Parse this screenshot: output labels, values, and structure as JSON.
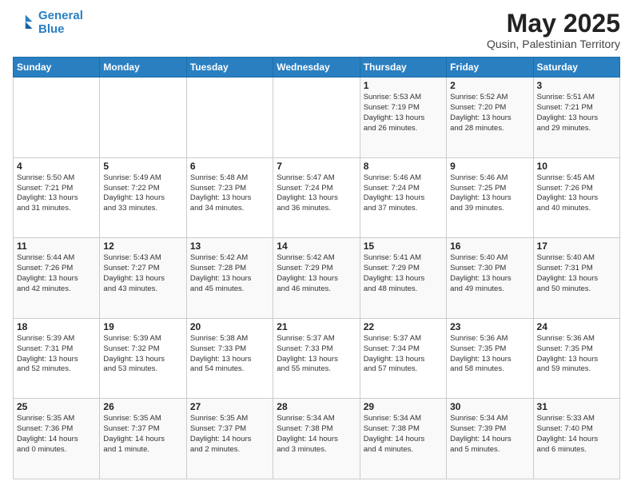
{
  "header": {
    "logo_line1": "General",
    "logo_line2": "Blue",
    "title": "May 2025",
    "subtitle": "Qusin, Palestinian Territory"
  },
  "days_of_week": [
    "Sunday",
    "Monday",
    "Tuesday",
    "Wednesday",
    "Thursday",
    "Friday",
    "Saturday"
  ],
  "weeks": [
    [
      {
        "day": "",
        "info": ""
      },
      {
        "day": "",
        "info": ""
      },
      {
        "day": "",
        "info": ""
      },
      {
        "day": "",
        "info": ""
      },
      {
        "day": "1",
        "info": "Sunrise: 5:53 AM\nSunset: 7:19 PM\nDaylight: 13 hours\nand 26 minutes."
      },
      {
        "day": "2",
        "info": "Sunrise: 5:52 AM\nSunset: 7:20 PM\nDaylight: 13 hours\nand 28 minutes."
      },
      {
        "day": "3",
        "info": "Sunrise: 5:51 AM\nSunset: 7:21 PM\nDaylight: 13 hours\nand 29 minutes."
      }
    ],
    [
      {
        "day": "4",
        "info": "Sunrise: 5:50 AM\nSunset: 7:21 PM\nDaylight: 13 hours\nand 31 minutes."
      },
      {
        "day": "5",
        "info": "Sunrise: 5:49 AM\nSunset: 7:22 PM\nDaylight: 13 hours\nand 33 minutes."
      },
      {
        "day": "6",
        "info": "Sunrise: 5:48 AM\nSunset: 7:23 PM\nDaylight: 13 hours\nand 34 minutes."
      },
      {
        "day": "7",
        "info": "Sunrise: 5:47 AM\nSunset: 7:24 PM\nDaylight: 13 hours\nand 36 minutes."
      },
      {
        "day": "8",
        "info": "Sunrise: 5:46 AM\nSunset: 7:24 PM\nDaylight: 13 hours\nand 37 minutes."
      },
      {
        "day": "9",
        "info": "Sunrise: 5:46 AM\nSunset: 7:25 PM\nDaylight: 13 hours\nand 39 minutes."
      },
      {
        "day": "10",
        "info": "Sunrise: 5:45 AM\nSunset: 7:26 PM\nDaylight: 13 hours\nand 40 minutes."
      }
    ],
    [
      {
        "day": "11",
        "info": "Sunrise: 5:44 AM\nSunset: 7:26 PM\nDaylight: 13 hours\nand 42 minutes."
      },
      {
        "day": "12",
        "info": "Sunrise: 5:43 AM\nSunset: 7:27 PM\nDaylight: 13 hours\nand 43 minutes."
      },
      {
        "day": "13",
        "info": "Sunrise: 5:42 AM\nSunset: 7:28 PM\nDaylight: 13 hours\nand 45 minutes."
      },
      {
        "day": "14",
        "info": "Sunrise: 5:42 AM\nSunset: 7:29 PM\nDaylight: 13 hours\nand 46 minutes."
      },
      {
        "day": "15",
        "info": "Sunrise: 5:41 AM\nSunset: 7:29 PM\nDaylight: 13 hours\nand 48 minutes."
      },
      {
        "day": "16",
        "info": "Sunrise: 5:40 AM\nSunset: 7:30 PM\nDaylight: 13 hours\nand 49 minutes."
      },
      {
        "day": "17",
        "info": "Sunrise: 5:40 AM\nSunset: 7:31 PM\nDaylight: 13 hours\nand 50 minutes."
      }
    ],
    [
      {
        "day": "18",
        "info": "Sunrise: 5:39 AM\nSunset: 7:31 PM\nDaylight: 13 hours\nand 52 minutes."
      },
      {
        "day": "19",
        "info": "Sunrise: 5:39 AM\nSunset: 7:32 PM\nDaylight: 13 hours\nand 53 minutes."
      },
      {
        "day": "20",
        "info": "Sunrise: 5:38 AM\nSunset: 7:33 PM\nDaylight: 13 hours\nand 54 minutes."
      },
      {
        "day": "21",
        "info": "Sunrise: 5:37 AM\nSunset: 7:33 PM\nDaylight: 13 hours\nand 55 minutes."
      },
      {
        "day": "22",
        "info": "Sunrise: 5:37 AM\nSunset: 7:34 PM\nDaylight: 13 hours\nand 57 minutes."
      },
      {
        "day": "23",
        "info": "Sunrise: 5:36 AM\nSunset: 7:35 PM\nDaylight: 13 hours\nand 58 minutes."
      },
      {
        "day": "24",
        "info": "Sunrise: 5:36 AM\nSunset: 7:35 PM\nDaylight: 13 hours\nand 59 minutes."
      }
    ],
    [
      {
        "day": "25",
        "info": "Sunrise: 5:35 AM\nSunset: 7:36 PM\nDaylight: 14 hours\nand 0 minutes."
      },
      {
        "day": "26",
        "info": "Sunrise: 5:35 AM\nSunset: 7:37 PM\nDaylight: 14 hours\nand 1 minute."
      },
      {
        "day": "27",
        "info": "Sunrise: 5:35 AM\nSunset: 7:37 PM\nDaylight: 14 hours\nand 2 minutes."
      },
      {
        "day": "28",
        "info": "Sunrise: 5:34 AM\nSunset: 7:38 PM\nDaylight: 14 hours\nand 3 minutes."
      },
      {
        "day": "29",
        "info": "Sunrise: 5:34 AM\nSunset: 7:38 PM\nDaylight: 14 hours\nand 4 minutes."
      },
      {
        "day": "30",
        "info": "Sunrise: 5:34 AM\nSunset: 7:39 PM\nDaylight: 14 hours\nand 5 minutes."
      },
      {
        "day": "31",
        "info": "Sunrise: 5:33 AM\nSunset: 7:40 PM\nDaylight: 14 hours\nand 6 minutes."
      }
    ]
  ]
}
